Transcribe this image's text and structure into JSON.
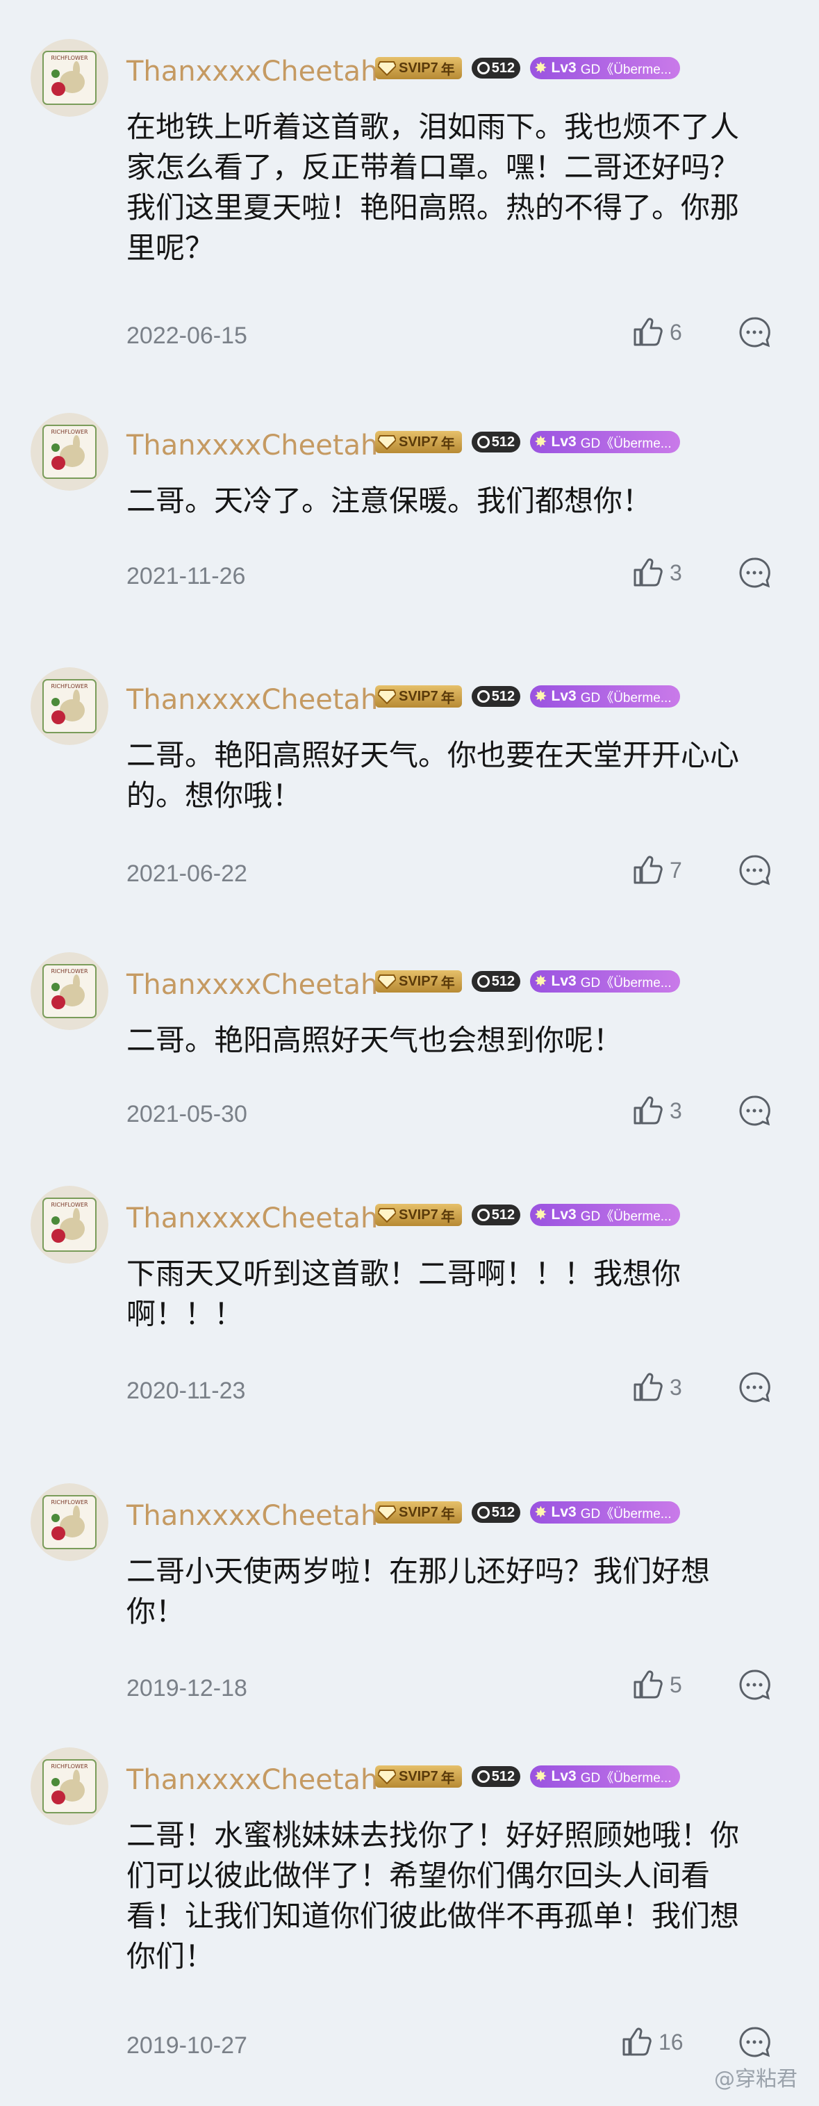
{
  "comments": [
    {
      "username": "ThanxxxxCheetah",
      "svip": "SVIP7",
      "svip_suffix": "年",
      "music_badge": "512",
      "level": "Lv3",
      "level_tag": "GD《Überme...",
      "text": "在地铁上听着这首歌，泪如雨下。我也烦不了人家怎么看了，反正带着口罩。嘿！二哥还好吗？我们这里夏天啦！艳阳高照。热的不得了。你那里呢？",
      "date": "2022-06-15",
      "likes": "6"
    },
    {
      "username": "ThanxxxxCheetah",
      "svip": "SVIP7",
      "svip_suffix": "年",
      "music_badge": "512",
      "level": "Lv3",
      "level_tag": "GD《Überme...",
      "text": "二哥。天冷了。注意保暖。我们都想你！",
      "date": "2021-11-26",
      "likes": "3"
    },
    {
      "username": "ThanxxxxCheetah",
      "svip": "SVIP7",
      "svip_suffix": "年",
      "music_badge": "512",
      "level": "Lv3",
      "level_tag": "GD《Überme...",
      "text": "二哥。艳阳高照好天气。你也要在天堂开开心心的。想你哦！",
      "date": "2021-06-22",
      "likes": "7"
    },
    {
      "username": "ThanxxxxCheetah",
      "svip": "SVIP7",
      "svip_suffix": "年",
      "music_badge": "512",
      "level": "Lv3",
      "level_tag": "GD《Überme...",
      "text": "二哥。艳阳高照好天气也会想到你呢！",
      "date": "2021-05-30",
      "likes": "3"
    },
    {
      "username": "ThanxxxxCheetah",
      "svip": "SVIP7",
      "svip_suffix": "年",
      "music_badge": "512",
      "level": "Lv3",
      "level_tag": "GD《Überme...",
      "text": "下雨天又听到这首歌！二哥啊！！！我想你啊！！！",
      "date": "2020-11-23",
      "likes": "3"
    },
    {
      "username": "ThanxxxxCheetah",
      "svip": "SVIP7",
      "svip_suffix": "年",
      "music_badge": "512",
      "level": "Lv3",
      "level_tag": "GD《Überme...",
      "text": "二哥小天使两岁啦！在那儿还好吗？我们好想你！",
      "date": "2019-12-18",
      "likes": "5"
    },
    {
      "username": "ThanxxxxCheetah",
      "svip": "SVIP7",
      "svip_suffix": "年",
      "music_badge": "512",
      "level": "Lv3",
      "level_tag": "GD《Überme...",
      "text": "二哥！水蜜桃妹妹去找你了！好好照顾她哦！你们可以彼此做伴了！希望你们偶尔回头人间看看！让我们知道你们彼此做伴不再孤单！我们想你们！",
      "date": "2019-10-27",
      "likes": "16"
    }
  ],
  "watermark": "@穿粘君",
  "colors": {
    "background": "#edf1f5",
    "username": "#c59a62",
    "date": "#7a8088",
    "text": "#151515"
  },
  "icons": {
    "like": "thumbs-up-icon",
    "more": "comment-more-icon",
    "vip": "diamond-icon",
    "level": "sparkle-icon"
  }
}
